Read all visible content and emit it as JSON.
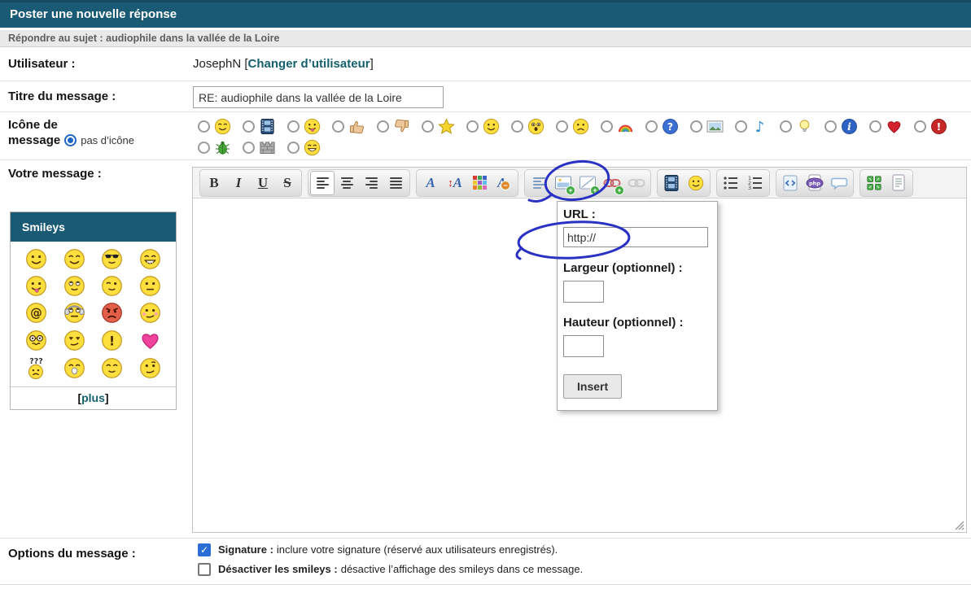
{
  "header": {
    "title": "Poster une nouvelle réponse"
  },
  "subheader": {
    "text": "Répondre au sujet : audiophile dans la vallée de la Loire"
  },
  "user": {
    "label": "Utilisateur :",
    "name": "JosephN",
    "bracket_l": "[",
    "change_link": "Changer d’utilisateur",
    "bracket_r": "]"
  },
  "title_field": {
    "label": "Titre du message :",
    "value": "RE: audiophile dans la vallée de la Loire"
  },
  "icon_row": {
    "label_line1": "Icône de",
    "label_line2": "message",
    "none_label": "pas d’icône",
    "none_selected": true,
    "row1": [
      "smiley-cheeky",
      "film",
      "smiley-tongue",
      "thumbs-up",
      "thumbs-down",
      "star",
      "smiley-grin",
      "smiley-surprised",
      "smiley-frown",
      "rainbow",
      "question-mark",
      "picture",
      "music-note",
      "light-bulb",
      "info",
      "heart-red",
      "exclamation-red"
    ],
    "row2": [
      "bug",
      "brick-wall",
      "smiley-laugh"
    ]
  },
  "message": {
    "label": "Votre message :"
  },
  "smileys": {
    "title": "Smileys",
    "bracket_l": "[",
    "more": "plus",
    "bracket_r": "]",
    "grid": [
      "smile",
      "happy",
      "cool",
      "biggrin",
      "tongue",
      "rolleyes",
      "wink",
      "neutral",
      "at-sign",
      "headphones",
      "angry",
      "blush",
      "dizzy",
      "skeptical",
      "exclaim-face",
      "heart-pink",
      "confused",
      "idea",
      "content",
      "thinking"
    ]
  },
  "toolbar": {
    "groups": [
      [
        {
          "name": "bold"
        },
        {
          "name": "italic"
        },
        {
          "name": "underline"
        },
        {
          "name": "strikethrough"
        }
      ],
      [
        {
          "name": "align-left",
          "active": true
        },
        {
          "name": "align-center"
        },
        {
          "name": "align-right"
        },
        {
          "name": "align-justify"
        }
      ],
      [
        {
          "name": "font-color"
        },
        {
          "name": "font-size"
        },
        {
          "name": "color-palette"
        },
        {
          "name": "remove-format"
        }
      ],
      [
        {
          "name": "text-float"
        },
        {
          "name": "insert-image"
        },
        {
          "name": "insert-flash"
        },
        {
          "name": "insert-link"
        },
        {
          "name": "unlink",
          "disabled": true
        }
      ],
      [
        {
          "name": "insert-video"
        },
        {
          "name": "insert-smiley"
        }
      ],
      [
        {
          "name": "bullet-list"
        },
        {
          "name": "numbered-list"
        }
      ],
      [
        {
          "name": "insert-code"
        },
        {
          "name": "insert-php"
        },
        {
          "name": "insert-quote"
        }
      ],
      [
        {
          "name": "maximize"
        },
        {
          "name": "view-source"
        }
      ]
    ]
  },
  "popup": {
    "url_label": "URL :",
    "url_value": "http://",
    "width_label": "Largeur (optionnel) :",
    "width_value": "",
    "height_label": "Hauteur (optionnel) :",
    "height_value": "",
    "insert_label": "Insert"
  },
  "options": {
    "label": "Options du message :",
    "items": [
      {
        "checked": true,
        "bold": "Signature :",
        "text": "inclure votre signature (réservé aux utilisateurs enregistrés)."
      },
      {
        "checked": false,
        "bold": "Désactiver les smileys :",
        "text": "désactive l’affichage des smileys dans ce message."
      }
    ]
  },
  "colors": {
    "header_bg": "#1a5a74",
    "link_teal": "#16606e",
    "annotation_pen": "#2a32c4",
    "radio_selected": "#1f66c9",
    "checkbox_checked": "#2b6fd6"
  }
}
